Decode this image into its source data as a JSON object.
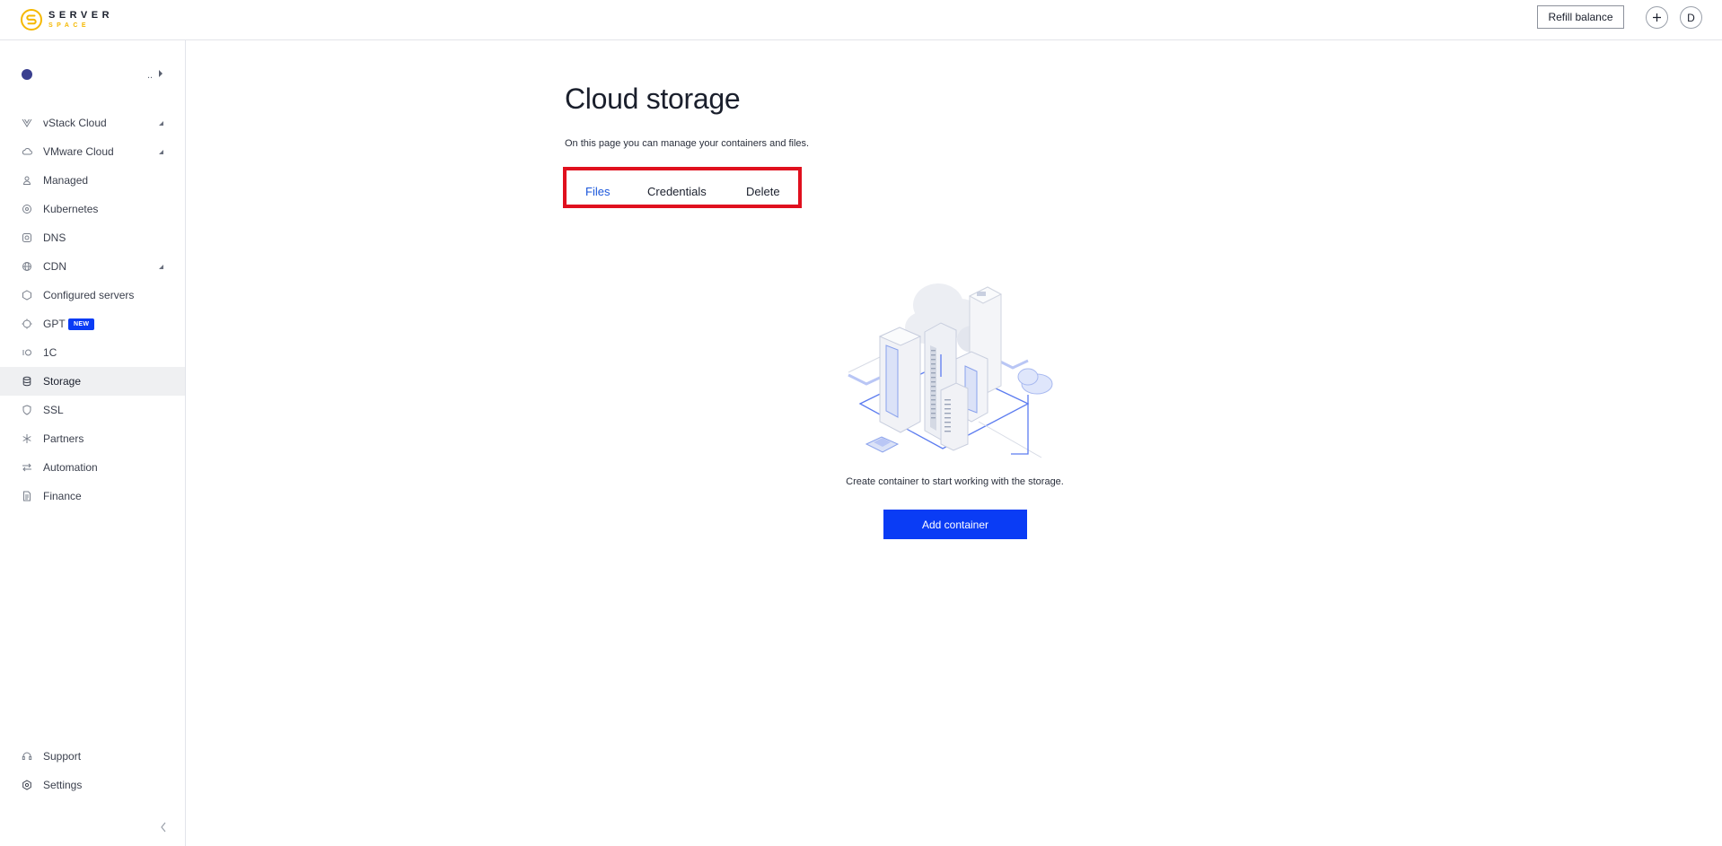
{
  "header": {
    "logo_top": "SERVER",
    "logo_bottom": "SPACE",
    "refill_label": "Refill balance",
    "plus_label": "+",
    "avatar_initial": "D"
  },
  "sidebar": {
    "account_dots": "..",
    "items": [
      {
        "label": "vStack Cloud",
        "icon": "vstack-icon",
        "has_caret": true
      },
      {
        "label": "VMware Cloud",
        "icon": "cloud-icon",
        "has_caret": true
      },
      {
        "label": "Managed",
        "icon": "person-icon",
        "has_caret": false
      },
      {
        "label": "Kubernetes",
        "icon": "kubernetes-icon",
        "has_caret": false
      },
      {
        "label": "DNS",
        "icon": "dns-icon",
        "has_caret": false
      },
      {
        "label": "CDN",
        "icon": "globe-icon",
        "has_caret": true
      },
      {
        "label": "Configured servers",
        "icon": "hexagon-icon",
        "has_caret": false
      },
      {
        "label": "GPT",
        "icon": "chip-icon",
        "has_caret": false,
        "badge": "NEW"
      },
      {
        "label": "1C",
        "icon": "onec-icon",
        "has_caret": false
      },
      {
        "label": "Storage",
        "icon": "database-icon",
        "has_caret": false,
        "active": true
      },
      {
        "label": "SSL",
        "icon": "shield-icon",
        "has_caret": false
      },
      {
        "label": "Partners",
        "icon": "asterisk-icon",
        "has_caret": false
      },
      {
        "label": "Automation",
        "icon": "arrows-icon",
        "has_caret": false
      },
      {
        "label": "Finance",
        "icon": "document-icon",
        "has_caret": false
      }
    ],
    "bottom_items": [
      {
        "label": "Support",
        "icon": "headset-icon"
      },
      {
        "label": "Settings",
        "icon": "gear-icon"
      }
    ]
  },
  "main": {
    "title": "Cloud storage",
    "description": "On this page you can manage your containers and files.",
    "tabs": [
      {
        "label": "Files",
        "active": true
      },
      {
        "label": "Credentials",
        "active": false
      },
      {
        "label": "Delete",
        "active": false
      }
    ],
    "empty_message": "Create container to start working with the storage.",
    "add_button": "Add container"
  },
  "colors": {
    "accent": "#0a3cf5",
    "active_tab": "#1a56db",
    "highlight_border": "#e0101e",
    "logo_yellow": "#f5b800"
  }
}
